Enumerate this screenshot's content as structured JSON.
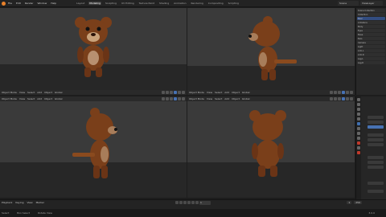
{
  "app": {
    "menus": [
      "File",
      "Edit",
      "Render",
      "Window",
      "Help"
    ],
    "tabs": [
      "Layout",
      "Modeling",
      "Sculpting",
      "UV Editing",
      "Texture Paint",
      "Shading",
      "Animation",
      "Rendering",
      "Compositing",
      "Scripting"
    ],
    "active_tab": "Modeling",
    "scene": "Scene",
    "view_layer": "ViewLayer"
  },
  "viewports": [
    {
      "mode": "Object Mode",
      "menu": [
        "View",
        "Select",
        "Add",
        "Object"
      ],
      "shading": "Global"
    },
    {
      "mode": "Object Mode",
      "menu": [
        "View",
        "Select",
        "Add",
        "Object"
      ],
      "shading": "Global"
    },
    {
      "mode": "Object Mode",
      "menu": [
        "View",
        "Select",
        "Add",
        "Object"
      ],
      "shading": "Global"
    },
    {
      "mode": "Object Mode",
      "menu": [
        "View",
        "Select",
        "Add",
        "Object"
      ],
      "shading": "Global"
    }
  ],
  "outliner": {
    "rows": [
      "Scene Collection",
      "Collection",
      "Bear",
      "Armature",
      "Body",
      "Eyes",
      "Nose",
      "Ears",
      "Camera",
      "Light",
      "Arm.L",
      "Arm.R",
      "Leg.L",
      "Leg.R"
    ],
    "selected_index": 2
  },
  "timeline": {
    "menu": [
      "Playback",
      "Keying",
      "View",
      "Marker"
    ],
    "current_frame": "1",
    "start": "1",
    "end": "250"
  },
  "status": {
    "left": [
      "Select",
      "Box Select",
      "Rotate View"
    ],
    "version": "3.0.0"
  },
  "colors": {
    "accent": "#4772b3",
    "bear_fur": "#7a3f1a",
    "bear_dark": "#5a2c12"
  }
}
